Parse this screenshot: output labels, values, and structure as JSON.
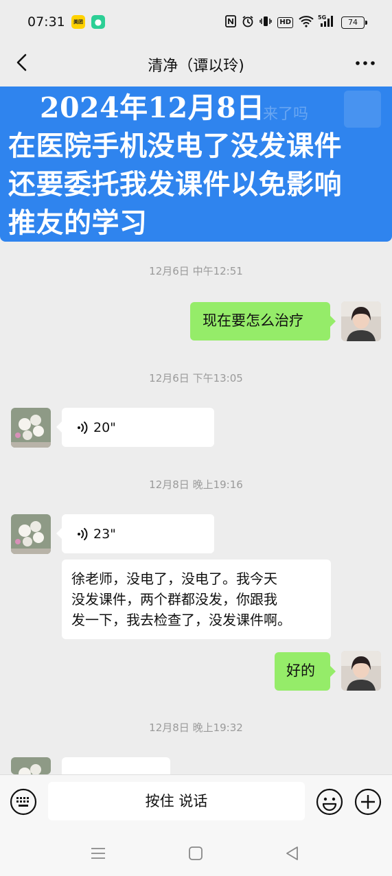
{
  "status_bar": {
    "time": "07:31",
    "app_badge_1": "美团",
    "network_label": "HD",
    "signal_label": "5G",
    "battery": "74"
  },
  "nav": {
    "title": "清净（谭以玲)"
  },
  "caption": {
    "lines": [
      "2024年12月8日",
      "在医院手机没电了没发课件",
      "还要委托我发课件以免影响",
      "推友的学习"
    ],
    "background_fragment": "来了吗"
  },
  "messages": [
    {
      "type": "timestamp",
      "text": "12月6日 中午12:51"
    },
    {
      "type": "text",
      "side": "right",
      "text": "现在要怎么治疗"
    },
    {
      "type": "timestamp",
      "text": "12月6日 下午13:05"
    },
    {
      "type": "voice",
      "side": "left",
      "duration": "20\""
    },
    {
      "type": "timestamp",
      "text": "12月8日 晚上19:16"
    },
    {
      "type": "voice",
      "side": "left",
      "duration": "23\""
    },
    {
      "type": "text",
      "side": "left",
      "lines": [
        "徐老师，没电了，没电了。我今天",
        "没发课件，两个群都没发，你跟我",
        "发一下，我去检查了，没发课件啊。"
      ]
    },
    {
      "type": "text",
      "side": "right",
      "text": "好的"
    },
    {
      "type": "timestamp",
      "text": "12月8日 晚上19:32"
    },
    {
      "type": "voice",
      "side": "left",
      "duration": ""
    }
  ],
  "input_bar": {
    "hold_to_talk": "按住 说话"
  },
  "icons": {
    "back": "chevron-left-icon",
    "more": "more-dots-icon",
    "keyboard": "keyboard-icon",
    "emoji": "emoji-icon",
    "plus": "plus-icon",
    "voice": "voice-wave-icon"
  },
  "colors": {
    "chat_background": "#ededed",
    "my_bubble": "#95ec69",
    "their_bubble": "#ffffff",
    "caption_blue": "#2f84ee"
  }
}
